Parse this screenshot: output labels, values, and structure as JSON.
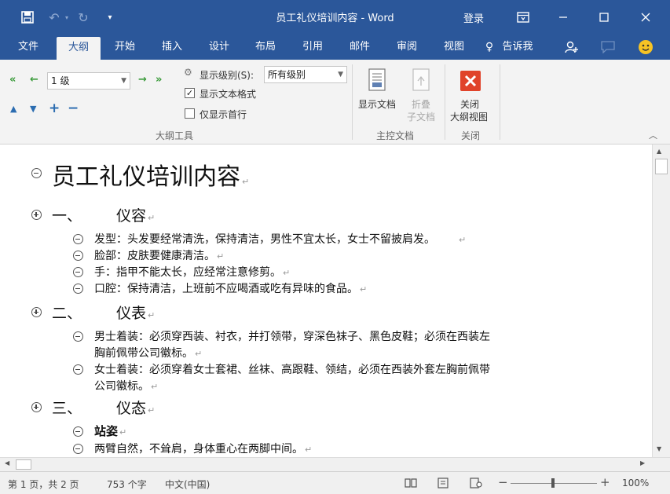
{
  "window": {
    "title": "员工礼仪培训内容 - Word",
    "login_label": "登录"
  },
  "tabs": [
    {
      "label": "文件"
    },
    {
      "label": "大纲"
    },
    {
      "label": "开始"
    },
    {
      "label": "插入"
    },
    {
      "label": "设计"
    },
    {
      "label": "布局"
    },
    {
      "label": "引用"
    },
    {
      "label": "邮件"
    },
    {
      "label": "审阅"
    },
    {
      "label": "视图"
    },
    {
      "label": "告诉我"
    }
  ],
  "ribbon": {
    "outline_tools": {
      "level_value": "1 级",
      "show_level_label": "显示级别(S):",
      "show_level_value": "所有级别",
      "show_text_format_label": "显示文本格式",
      "show_text_format_checked": true,
      "show_first_line_label": "仅显示首行",
      "show_first_line_checked": false,
      "group_label": "大纲工具"
    },
    "master_document": {
      "show_document_label": "显示文档",
      "collapse_subdocuments_label_1": "折叠",
      "collapse_subdocuments_label_2": "子文档",
      "group_label": "主控文档"
    },
    "close": {
      "close_label_1": "关闭",
      "close_label_2": "大纲视图",
      "group_label": "关闭"
    }
  },
  "document": {
    "title": "员工礼仪培训内容",
    "sections": [
      {
        "number": "一、",
        "heading": "仪容",
        "items": [
          [
            "发型：头发要经常清洗，保持清洁，男性不宜太长，女士不留披肩发。"
          ],
          [
            "脸部：皮肤要健康清洁。"
          ],
          [
            "手：指甲不能太长，应经常注意修剪。"
          ],
          [
            "口腔：保持清洁，上班前不应喝酒或吃有异味的食品。"
          ]
        ]
      },
      {
        "number": "二、",
        "heading": "仪表",
        "items": [
          [
            "男士着装：必须穿西装、衬衣，并打领带，穿深色袜子、黑色皮鞋；必须在西装左",
            "胸前佩带公司徽标。"
          ],
          [
            "女士着装：必须穿着女士套裙、丝袜、高跟鞋、领结，必须在西装外套左胸前佩带",
            "公司徽标。"
          ]
        ]
      },
      {
        "number": "三、",
        "heading": "仪态",
        "items": [
          [
            "站姿"
          ],
          [
            "两臂自然，不耸肩，身体重心在两脚中间。"
          ]
        ]
      }
    ],
    "paragraph_mark": "↵"
  },
  "status_bar": {
    "page_info": "第 1 页，共 2 页",
    "word_count": "753 个字",
    "language": "中文(中国)",
    "zoom": "100%"
  },
  "colors": {
    "brand": "#2b579a",
    "ribbon_bg": "#f3f3f3",
    "close_icon": "#e0432a",
    "promote_arrow": "#3a9b3a"
  }
}
